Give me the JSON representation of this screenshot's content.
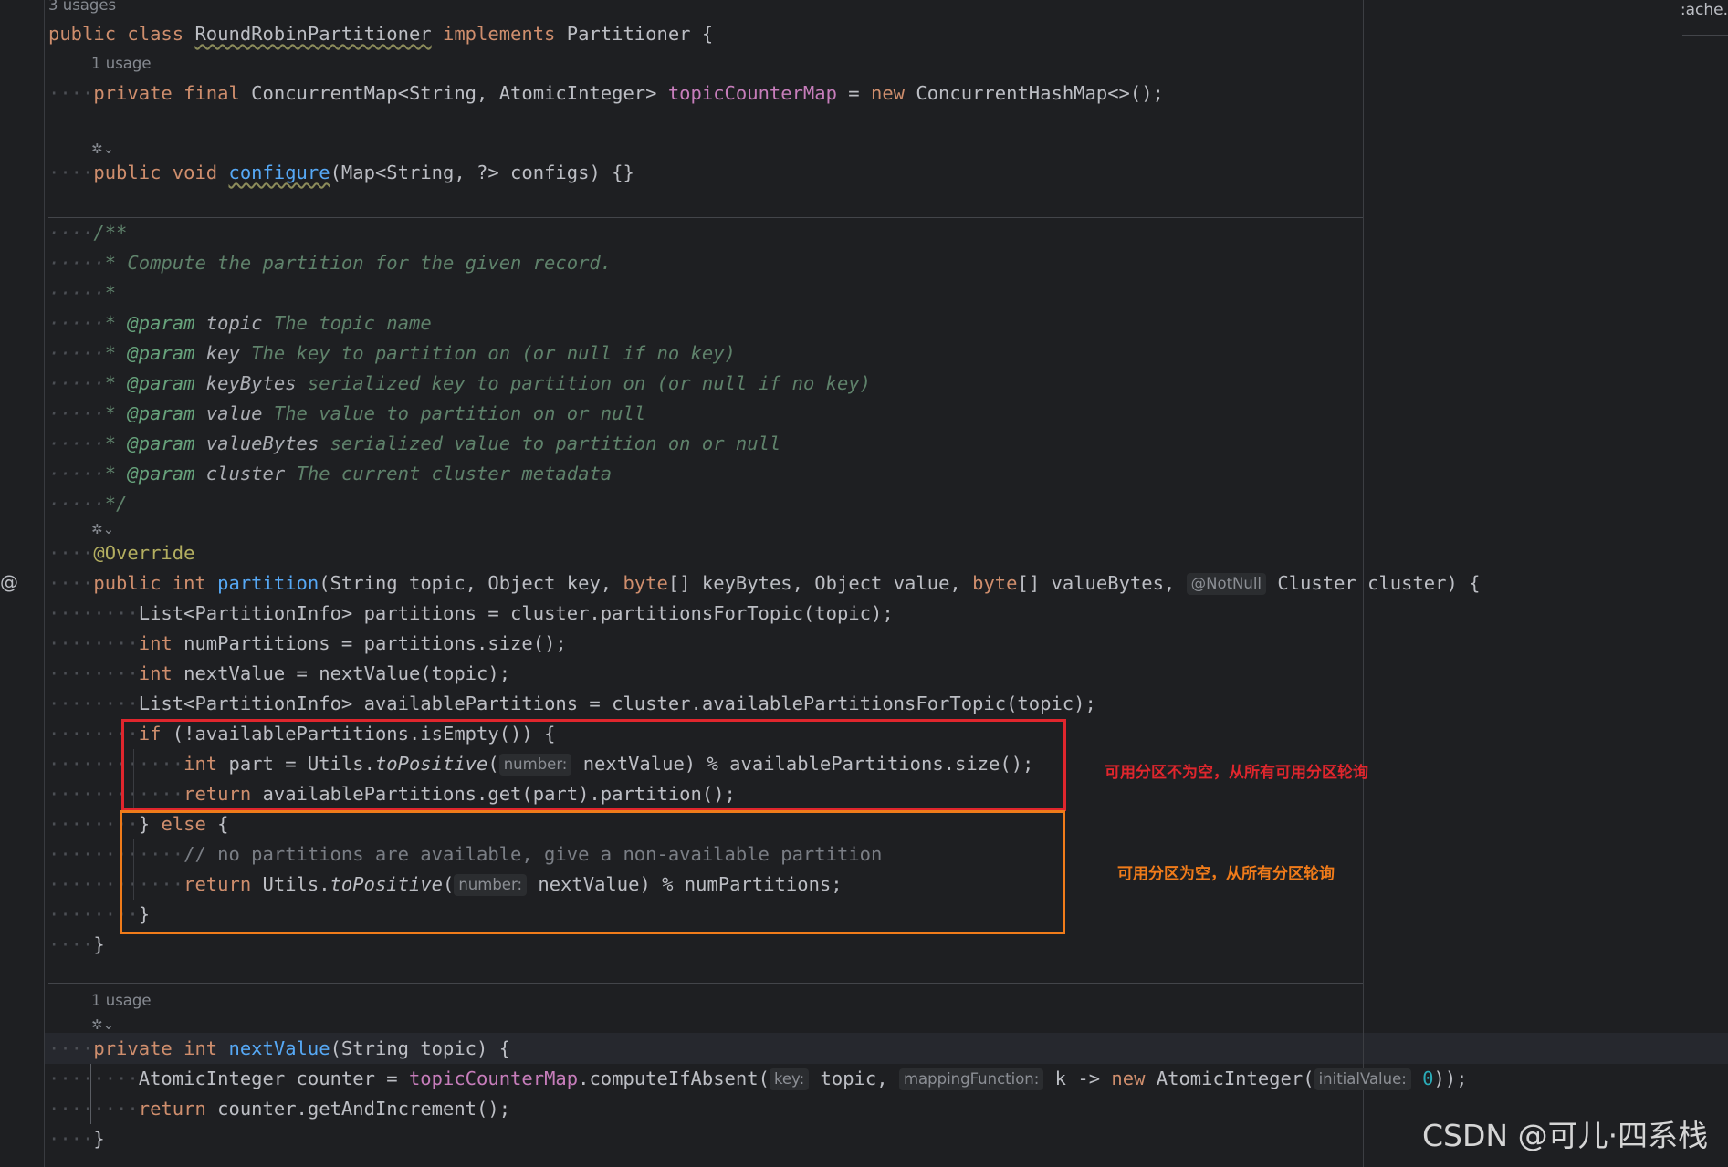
{
  "editor": {
    "top_tab_fragment": ":ache.",
    "usages_3": "3 usages",
    "usages_1a": "1 usage",
    "usages_1b": "1 usage",
    "not_null_hint": "@NotNull",
    "inlay_number_1": "number:",
    "inlay_number_2": "number:",
    "inlay_key": "key:",
    "inlay_mapping": "mappingFunction:",
    "inlay_initial": "initialValue:"
  },
  "annotations": {
    "red_note": "可用分区不为空，从所有可用分区轮询",
    "orange_note": "可用分区为空，从所有分区轮询",
    "red_color": "#e0262d",
    "orange_color": "#f07b1a"
  },
  "watermark": "CSDN @可儿·四系栈",
  "code": {
    "l_class": [
      "public class ",
      "RoundRobinPartitioner",
      " implements ",
      "Partitioner {"
    ],
    "l_field": [
      "private final ",
      "ConcurrentMap<String, AtomicInteger> ",
      "topicCounterMap",
      " = ",
      "new ",
      "ConcurrentHashMap<>();"
    ],
    "l_configure": [
      "public void ",
      "configure",
      "(Map<String, ?> configs) {}"
    ],
    "doc_open": "/**",
    "doc_1": "* Compute the partition for the given record.",
    "doc_2": "*",
    "doc_p1": [
      "* ",
      "@param",
      " topic",
      " The topic name"
    ],
    "doc_p2": [
      "* ",
      "@param",
      " key",
      " The key to partition on (or null if no key)"
    ],
    "doc_p3": [
      "* ",
      "@param",
      " keyBytes",
      " serialized key to partition on (or null if no key)"
    ],
    "doc_p4": [
      "* ",
      "@param",
      " value",
      " The value to partition on or null"
    ],
    "doc_p5": [
      "* ",
      "@param",
      " valueBytes",
      " serialized value to partition on or null"
    ],
    "doc_p6": [
      "* ",
      "@param",
      " cluster",
      " The current cluster metadata"
    ],
    "doc_close": "*/",
    "override": "@Override",
    "l_partition": [
      "public int ",
      "partition",
      "(String topic, Object key, ",
      "byte",
      "[] keyBytes, Object value, ",
      "byte",
      "[] valueBytes, ",
      "Cluster cluster) {"
    ],
    "l_list": "List<PartitionInfo> partitions = cluster.partitionsForTopic(topic);",
    "l_num": [
      "int ",
      "numPartitions = partitions.size();"
    ],
    "l_next": [
      "int ",
      "nextValue = nextValue(topic);"
    ],
    "l_avail": "List<PartitionInfo> availablePartitions = cluster.availablePartitionsForTopic(topic);",
    "l_if": [
      "if ",
      "(!availablePartitions.isEmpty()) {"
    ],
    "l_part": [
      "int ",
      "part = Utils.",
      "toPositive",
      "(",
      "nextValue) % availablePartitions.size();"
    ],
    "l_ret1": [
      "return ",
      "availablePartitions.get(part).partition();"
    ],
    "l_else": [
      "} ",
      "else ",
      "{"
    ],
    "l_cmt": "// no partitions are available, give a non-available partition",
    "l_ret2": [
      "return ",
      "Utils.",
      "toPositive",
      "(",
      "nextValue) % numPartitions;"
    ],
    "l_brace_inner": "}",
    "l_brace_method": "}",
    "l_nextvalue": [
      "private int ",
      "nextValue",
      "(String topic) {"
    ],
    "l_counter": [
      "AtomicInteger counter = ",
      "topicCounterMap",
      ".computeIfAbsent(",
      "topic, ",
      "k -> ",
      "new ",
      "AtomicInteger(",
      "0",
      "));"
    ],
    "l_ret3": [
      "return ",
      "counter.getAndIncrement();"
    ],
    "l_brace_last": "}"
  }
}
